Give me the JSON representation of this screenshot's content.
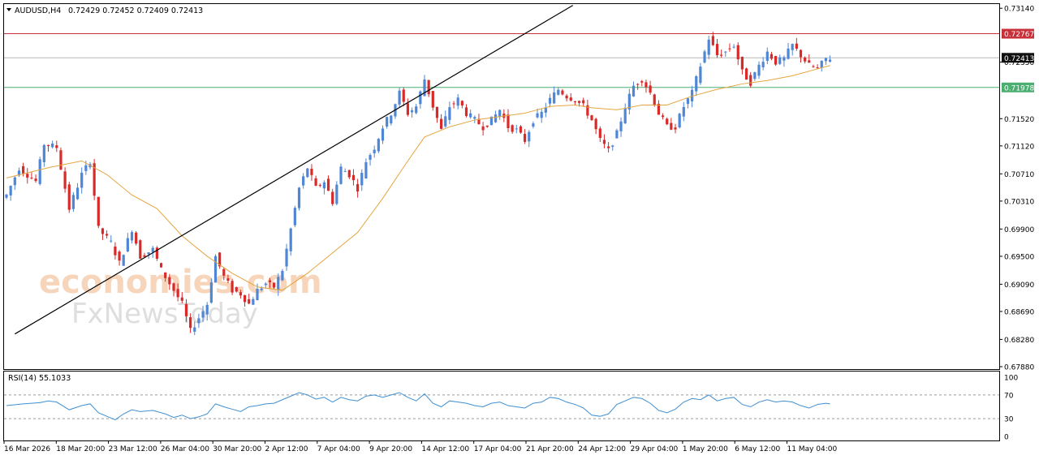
{
  "header": {
    "symbol": "AUDUSD,H4",
    "ohlc": "0.72429 0.72452 0.72409 0.72413"
  },
  "rsi_header": "RSI(14) 55.1033",
  "watermark": {
    "line1": "economies.com",
    "line2": "FxNewsToday"
  },
  "colors": {
    "bull": "#4f86d6",
    "bear": "#d92a2a",
    "ma": "#e6a53f",
    "trendline": "#000000",
    "resistance": "#c8303a",
    "support": "#4caf72",
    "current": "#111111",
    "rsi_line": "#3f8fd1"
  },
  "chart_data": [
    {
      "type": "candlestick",
      "instrument": "AUDUSD",
      "timeframe": "H4",
      "y_tick_labels": [
        "0.73140",
        "0.72767",
        "0.72413",
        "0.72350",
        "0.71978",
        "0.71520",
        "0.71120",
        "0.70710",
        "0.70310",
        "0.69900",
        "0.69500",
        "0.69090",
        "0.68690",
        "0.68280",
        "0.67880"
      ],
      "ylim": [
        0.6788,
        0.7319
      ],
      "x_tick_labels": [
        "16 Mar 2026",
        "18 Mar 20:00",
        "23 Mar 12:00",
        "26 Mar 04:00",
        "30 Mar 20:00",
        "2 Apr 12:00",
        "7 Apr 04:00",
        "9 Apr 20:00",
        "14 Apr 12:00",
        "17 Apr 04:00",
        "21 Apr 20:00",
        "24 Apr 12:00",
        "29 Apr 04:00",
        "1 May 20:00",
        "6 May 12:00",
        "11 May 04:00"
      ],
      "price_levels": [
        {
          "name": "resistance",
          "value": 0.72767,
          "label": "0.72767"
        },
        {
          "name": "current",
          "value": 0.72413,
          "label": "0.72413"
        },
        {
          "name": "support",
          "value": 0.71978,
          "label": "0.71978"
        }
      ],
      "trendline": {
        "from": {
          "bar": 2,
          "price": 0.6836
        },
        "to": {
          "bar": 118,
          "price": 0.7255
        }
      },
      "close_path": [
        [
          0,
          0.704
        ],
        [
          3,
          0.708
        ],
        [
          7,
          0.706
        ],
        [
          9,
          0.7115
        ],
        [
          12,
          0.711
        ],
        [
          15,
          0.702
        ],
        [
          18,
          0.707
        ],
        [
          20,
          0.709
        ],
        [
          22,
          0.699
        ],
        [
          25,
          0.697
        ],
        [
          27,
          0.694
        ],
        [
          30,
          0.699
        ],
        [
          32,
          0.695
        ],
        [
          35,
          0.696
        ],
        [
          37,
          0.693
        ],
        [
          40,
          0.69
        ],
        [
          42,
          0.688
        ],
        [
          44,
          0.684
        ],
        [
          46,
          0.686
        ],
        [
          48,
          0.688
        ],
        [
          50,
          0.695
        ],
        [
          52,
          0.692
        ],
        [
          54,
          0.69
        ],
        [
          56,
          0.6895
        ],
        [
          58,
          0.688
        ],
        [
          60,
          0.69
        ],
        [
          62,
          0.691
        ],
        [
          64,
          0.6905
        ],
        [
          66,
          0.693
        ],
        [
          68,
          0.699
        ],
        [
          70,
          0.705
        ],
        [
          72,
          0.708
        ],
        [
          74,
          0.705
        ],
        [
          76,
          0.706
        ],
        [
          78,
          0.703
        ],
        [
          80,
          0.708
        ],
        [
          82,
          0.707
        ],
        [
          84,
          0.705
        ],
        [
          86,
          0.709
        ],
        [
          88,
          0.711
        ],
        [
          90,
          0.714
        ],
        [
          92,
          0.716
        ],
        [
          94,
          0.719
        ],
        [
          96,
          0.716
        ],
        [
          98,
          0.717
        ],
        [
          100,
          0.721
        ],
        [
          102,
          0.717
        ],
        [
          104,
          0.7135
        ],
        [
          106,
          0.717
        ],
        [
          108,
          0.718
        ],
        [
          110,
          0.716
        ],
        [
          112,
          0.715
        ],
        [
          114,
          0.714
        ],
        [
          116,
          0.715
        ],
        [
          118,
          0.7165
        ],
        [
          120,
          0.714
        ],
        [
          122,
          0.7135
        ],
        [
          124,
          0.712
        ],
        [
          126,
          0.715
        ],
        [
          128,
          0.716
        ],
        [
          130,
          0.718
        ],
        [
          132,
          0.7195
        ],
        [
          134,
          0.7185
        ],
        [
          136,
          0.718
        ],
        [
          138,
          0.717
        ],
        [
          140,
          0.715
        ],
        [
          142,
          0.712
        ],
        [
          144,
          0.7105
        ],
        [
          146,
          0.713
        ],
        [
          148,
          0.717
        ],
        [
          150,
          0.72
        ],
        [
          152,
          0.721
        ],
        [
          154,
          0.719
        ],
        [
          156,
          0.716
        ],
        [
          158,
          0.714
        ],
        [
          160,
          0.714
        ],
        [
          162,
          0.717
        ],
        [
          164,
          0.719
        ],
        [
          166,
          0.723
        ],
        [
          168,
          0.727
        ],
        [
          170,
          0.7245
        ],
        [
          172,
          0.725
        ],
        [
          174,
          0.726
        ],
        [
          176,
          0.722
        ],
        [
          178,
          0.7205
        ],
        [
          180,
          0.723
        ],
        [
          182,
          0.725
        ],
        [
          184,
          0.7235
        ],
        [
          186,
          0.724
        ],
        [
          188,
          0.726
        ],
        [
          190,
          0.7245
        ],
        [
          192,
          0.723
        ],
        [
          194,
          0.7225
        ],
        [
          196,
          0.724
        ],
        [
          197,
          0.7241
        ]
      ],
      "moving_average": {
        "name": "MA",
        "path": [
          [
            0,
            0.7065
          ],
          [
            10,
            0.708
          ],
          [
            18,
            0.709
          ],
          [
            24,
            0.707
          ],
          [
            30,
            0.704
          ],
          [
            36,
            0.702
          ],
          [
            42,
            0.698
          ],
          [
            48,
            0.695
          ],
          [
            54,
            0.6925
          ],
          [
            60,
            0.6905
          ],
          [
            66,
            0.69
          ],
          [
            72,
            0.6925
          ],
          [
            78,
            0.6955
          ],
          [
            84,
            0.6985
          ],
          [
            90,
            0.7035
          ],
          [
            96,
            0.709
          ],
          [
            100,
            0.7125
          ],
          [
            106,
            0.714
          ],
          [
            112,
            0.715
          ],
          [
            118,
            0.7155
          ],
          [
            124,
            0.716
          ],
          [
            130,
            0.717
          ],
          [
            136,
            0.7172
          ],
          [
            140,
            0.7168
          ],
          [
            146,
            0.7165
          ],
          [
            152,
            0.7172
          ],
          [
            158,
            0.7172
          ],
          [
            164,
            0.7185
          ],
          [
            170,
            0.7195
          ],
          [
            176,
            0.7203
          ],
          [
            182,
            0.7208
          ],
          [
            188,
            0.7215
          ],
          [
            194,
            0.7225
          ],
          [
            197,
            0.723
          ]
        ]
      }
    },
    {
      "type": "line",
      "name": "RSI(14)",
      "ylim": [
        0,
        100
      ],
      "y_tick_labels": [
        "100",
        "70",
        "30",
        "0"
      ],
      "levels": [
        70,
        30
      ],
      "last_value": 55.1033,
      "path": [
        [
          0,
          52
        ],
        [
          4,
          55
        ],
        [
          8,
          57
        ],
        [
          10,
          60
        ],
        [
          12,
          58
        ],
        [
          15,
          45
        ],
        [
          18,
          52
        ],
        [
          20,
          55
        ],
        [
          22,
          40
        ],
        [
          24,
          34
        ],
        [
          26,
          28
        ],
        [
          28,
          38
        ],
        [
          30,
          45
        ],
        [
          32,
          42
        ],
        [
          35,
          44
        ],
        [
          38,
          38
        ],
        [
          40,
          32
        ],
        [
          42,
          36
        ],
        [
          44,
          30
        ],
        [
          46,
          33
        ],
        [
          48,
          38
        ],
        [
          50,
          55
        ],
        [
          52,
          50
        ],
        [
          54,
          46
        ],
        [
          56,
          42
        ],
        [
          58,
          50
        ],
        [
          60,
          52
        ],
        [
          62,
          55
        ],
        [
          64,
          56
        ],
        [
          66,
          62
        ],
        [
          68,
          68
        ],
        [
          70,
          74
        ],
        [
          72,
          70
        ],
        [
          74,
          63
        ],
        [
          76,
          66
        ],
        [
          78,
          58
        ],
        [
          80,
          66
        ],
        [
          82,
          62
        ],
        [
          84,
          60
        ],
        [
          86,
          68
        ],
        [
          88,
          70
        ],
        [
          90,
          66
        ],
        [
          92,
          70
        ],
        [
          94,
          74
        ],
        [
          96,
          66
        ],
        [
          98,
          60
        ],
        [
          100,
          72
        ],
        [
          102,
          56
        ],
        [
          104,
          50
        ],
        [
          106,
          60
        ],
        [
          108,
          58
        ],
        [
          110,
          56
        ],
        [
          112,
          52
        ],
        [
          114,
          50
        ],
        [
          116,
          56
        ],
        [
          118,
          58
        ],
        [
          120,
          52
        ],
        [
          122,
          50
        ],
        [
          124,
          48
        ],
        [
          126,
          56
        ],
        [
          128,
          58
        ],
        [
          130,
          66
        ],
        [
          132,
          64
        ],
        [
          134,
          58
        ],
        [
          136,
          54
        ],
        [
          138,
          48
        ],
        [
          140,
          36
        ],
        [
          142,
          34
        ],
        [
          144,
          38
        ],
        [
          146,
          54
        ],
        [
          148,
          60
        ],
        [
          150,
          66
        ],
        [
          152,
          64
        ],
        [
          154,
          56
        ],
        [
          156,
          44
        ],
        [
          158,
          40
        ],
        [
          160,
          46
        ],
        [
          162,
          58
        ],
        [
          164,
          64
        ],
        [
          166,
          62
        ],
        [
          168,
          70
        ],
        [
          170,
          60
        ],
        [
          172,
          64
        ],
        [
          174,
          66
        ],
        [
          176,
          54
        ],
        [
          178,
          50
        ],
        [
          180,
          58
        ],
        [
          182,
          62
        ],
        [
          184,
          58
        ],
        [
          186,
          60
        ],
        [
          188,
          58
        ],
        [
          190,
          52
        ],
        [
          192,
          48
        ],
        [
          194,
          54
        ],
        [
          196,
          56
        ],
        [
          197,
          55
        ]
      ]
    }
  ]
}
